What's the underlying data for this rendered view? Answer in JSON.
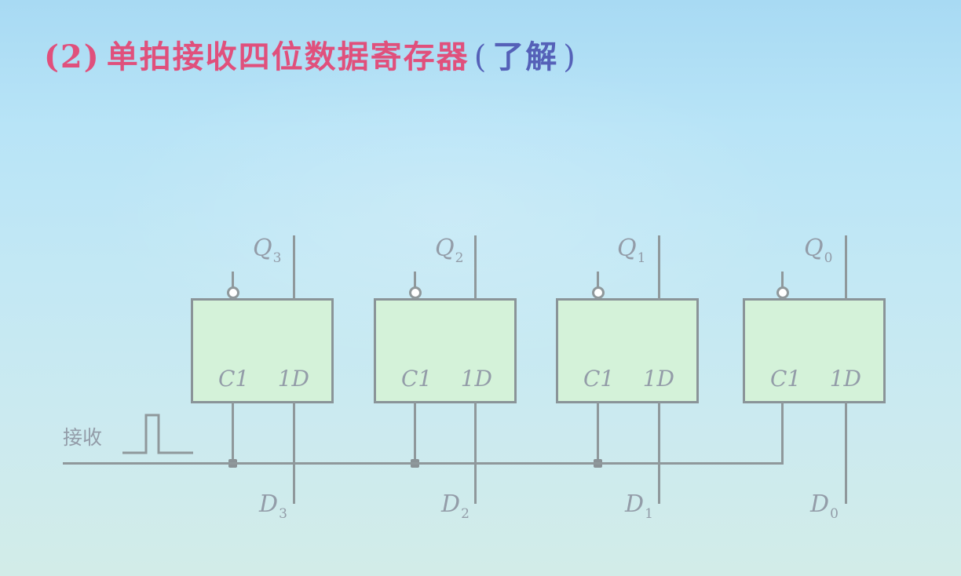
{
  "title": {
    "number": "(2)",
    "main": "单拍接收四位数据寄存器",
    "open_paren": "(",
    "note": "了解",
    "close_paren": ")"
  },
  "diagram": {
    "flip_flops": [
      {
        "clock_pin": "C1",
        "data_pin": "1D",
        "output_letter": "Q",
        "output_index": "3",
        "input_letter": "D",
        "input_index": "3"
      },
      {
        "clock_pin": "C1",
        "data_pin": "1D",
        "output_letter": "Q",
        "output_index": "2",
        "input_letter": "D",
        "input_index": "2"
      },
      {
        "clock_pin": "C1",
        "data_pin": "1D",
        "output_letter": "Q",
        "output_index": "1",
        "input_letter": "D",
        "input_index": "1"
      },
      {
        "clock_pin": "C1",
        "data_pin": "1D",
        "output_letter": "Q",
        "output_index": "0",
        "input_letter": "D",
        "input_index": "0"
      }
    ],
    "clock_input_label": "接收"
  },
  "colors": {
    "title_main": "#e0507c",
    "title_note": "#5561b8",
    "block_fill": "#d4f2d9",
    "wire": "#8f989b",
    "label": "#939ca8"
  }
}
